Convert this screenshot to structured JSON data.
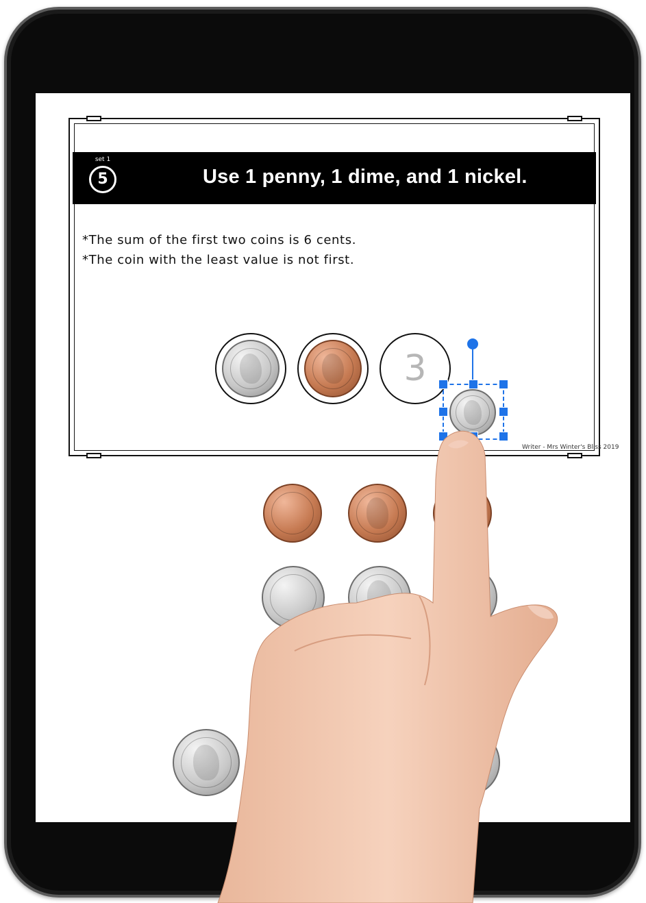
{
  "task": {
    "set_label": "set 1",
    "number": "5",
    "title": "Use 1 penny, 1 dime, and 1 nickel.",
    "clues": [
      "*The sum of the first two coins is 6 cents.",
      "*The coin with the least value is not first."
    ],
    "slot_third_number": "3",
    "credit": "Writer - Mrs Winter's Bliss 2019"
  },
  "coins": {
    "slot_1": "nickel",
    "slot_2": "penny",
    "dragged": "dime",
    "bank": [
      "penny-back",
      "penny",
      "penny",
      "nickel-back",
      "nickel",
      "nickel",
      "quarter",
      "quarter"
    ]
  },
  "colors": {
    "selection": "#1e73e8",
    "header_bg": "#000000",
    "frame": "#0b0b0b"
  }
}
